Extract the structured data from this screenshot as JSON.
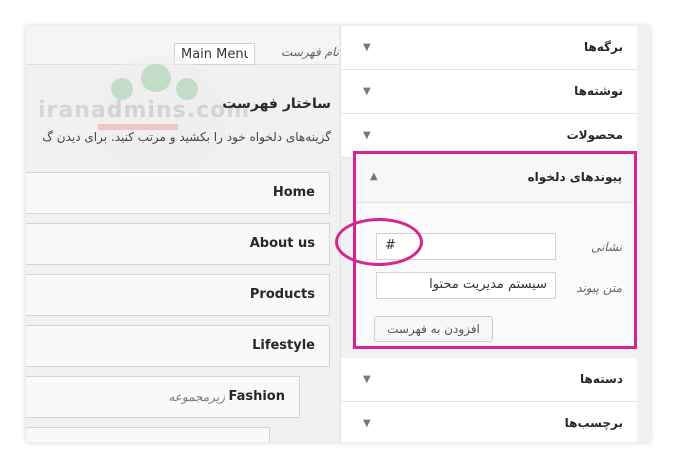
{
  "menu": {
    "name_label": "نام فهرست",
    "name_value": "Main Menu",
    "structure_title": "ساختار فهرست",
    "structure_desc": "گزینه‌های دلخواه خود را بکشید و مرتب کنید. برای دیدن گ",
    "items": [
      {
        "label": "Home"
      },
      {
        "label": "About us"
      },
      {
        "label": "Products"
      },
      {
        "label": "Lifestyle"
      },
      {
        "label": "Fashion",
        "sub": "زیرمجموعه"
      }
    ]
  },
  "watermark": {
    "text": "iranadmins.com"
  },
  "sidebar": {
    "sections": [
      {
        "label": "برگه‌ها",
        "icon": "triangle-down-icon"
      },
      {
        "label": "نوشته‌ها",
        "icon": "triangle-down-icon"
      },
      {
        "label": "محصولات",
        "icon": "triangle-down-icon"
      },
      {
        "label": "دسته‌ها",
        "icon": "triangle-down-icon"
      },
      {
        "label": "برچسب‌ها",
        "icon": "triangle-down-icon"
      }
    ],
    "custom_links": {
      "title": "پیوندهای دلخواه",
      "icon": "triangle-up-icon",
      "url_label": "نشانی",
      "url_value": "#",
      "text_label": "متن پیوند",
      "text_value": "سیستم مدیریت محتوا",
      "add_button": "افزودن به فهرست"
    }
  },
  "colors": {
    "highlight": "#d6258f"
  }
}
